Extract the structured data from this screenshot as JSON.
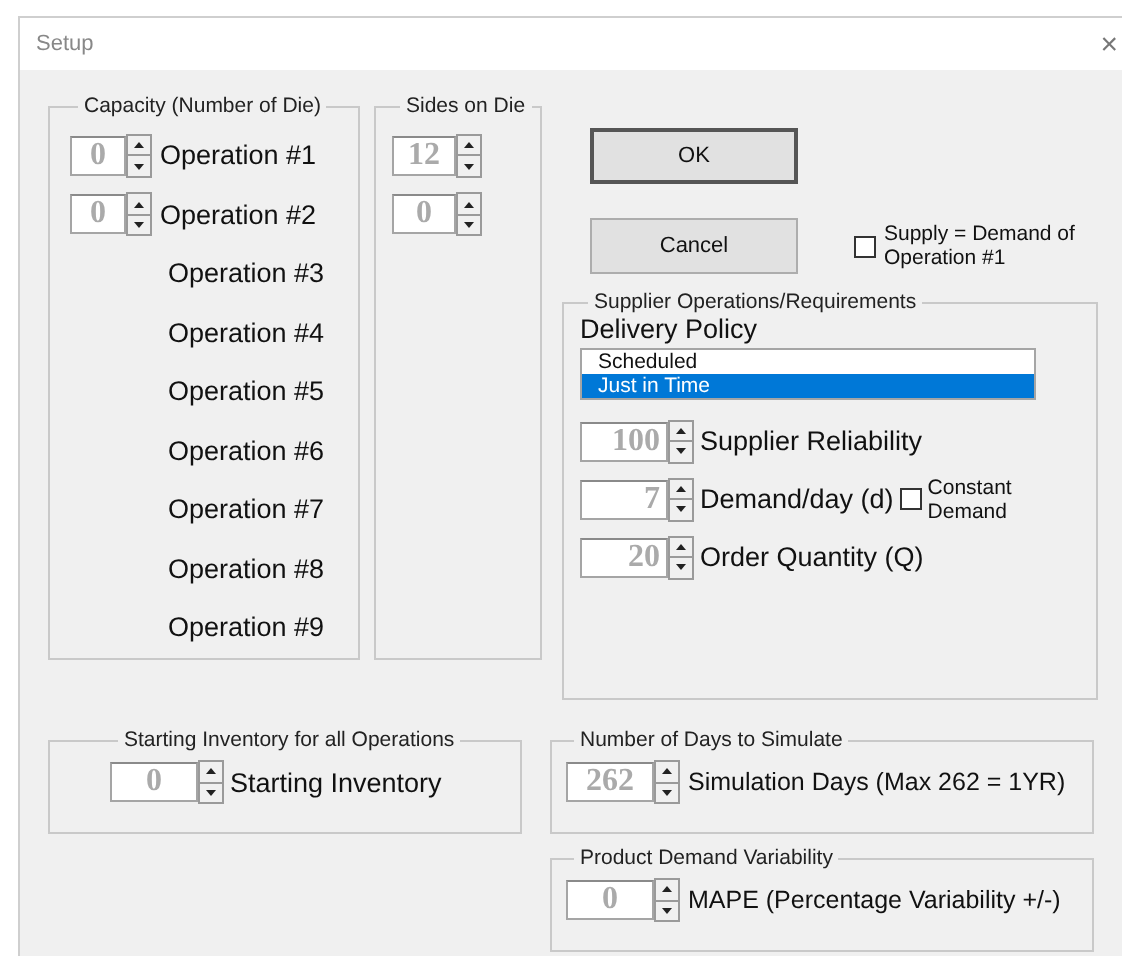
{
  "window": {
    "title": "Setup",
    "close": "×"
  },
  "capacity": {
    "title": "Capacity (Number of Die)",
    "operations": [
      {
        "label": "Operation #1",
        "value": "0"
      },
      {
        "label": "Operation #2",
        "value": "0"
      },
      {
        "label": "Operation #3"
      },
      {
        "label": "Operation #4"
      },
      {
        "label": "Operation #5"
      },
      {
        "label": "Operation #6"
      },
      {
        "label": "Operation #7"
      },
      {
        "label": "Operation #8"
      },
      {
        "label": "Operation #9"
      }
    ]
  },
  "sides": {
    "title": "Sides on Die",
    "values": [
      "12",
      "0"
    ]
  },
  "buttons": {
    "ok": "OK",
    "cancel": "Cancel"
  },
  "supply_checkbox": {
    "label": "Supply = Demand of Operation #1",
    "checked": false
  },
  "supplier": {
    "title": "Supplier Operations/Requirements",
    "policy_label": "Delivery Policy",
    "policies": [
      {
        "label": "Scheduled",
        "selected": false
      },
      {
        "label": "Just in Time",
        "selected": true
      }
    ],
    "fields": [
      {
        "value": "100",
        "label": "Supplier Reliability"
      },
      {
        "value": "7",
        "label": "Demand/day (d)",
        "checkbox": {
          "label": "Constant Demand",
          "checked": false
        }
      },
      {
        "value": "20",
        "label": "Order Quantity (Q)"
      }
    ]
  },
  "starting": {
    "title": "Starting Inventory for all Operations",
    "value": "0",
    "label": "Starting Inventory"
  },
  "days": {
    "title": "Number of Days to Simulate",
    "value": "262",
    "label": "Simulation Days (Max 262 = 1YR)"
  },
  "variability": {
    "title": "Product Demand Variability",
    "value": "0",
    "label": "MAPE (Percentage Variability +/-)"
  }
}
